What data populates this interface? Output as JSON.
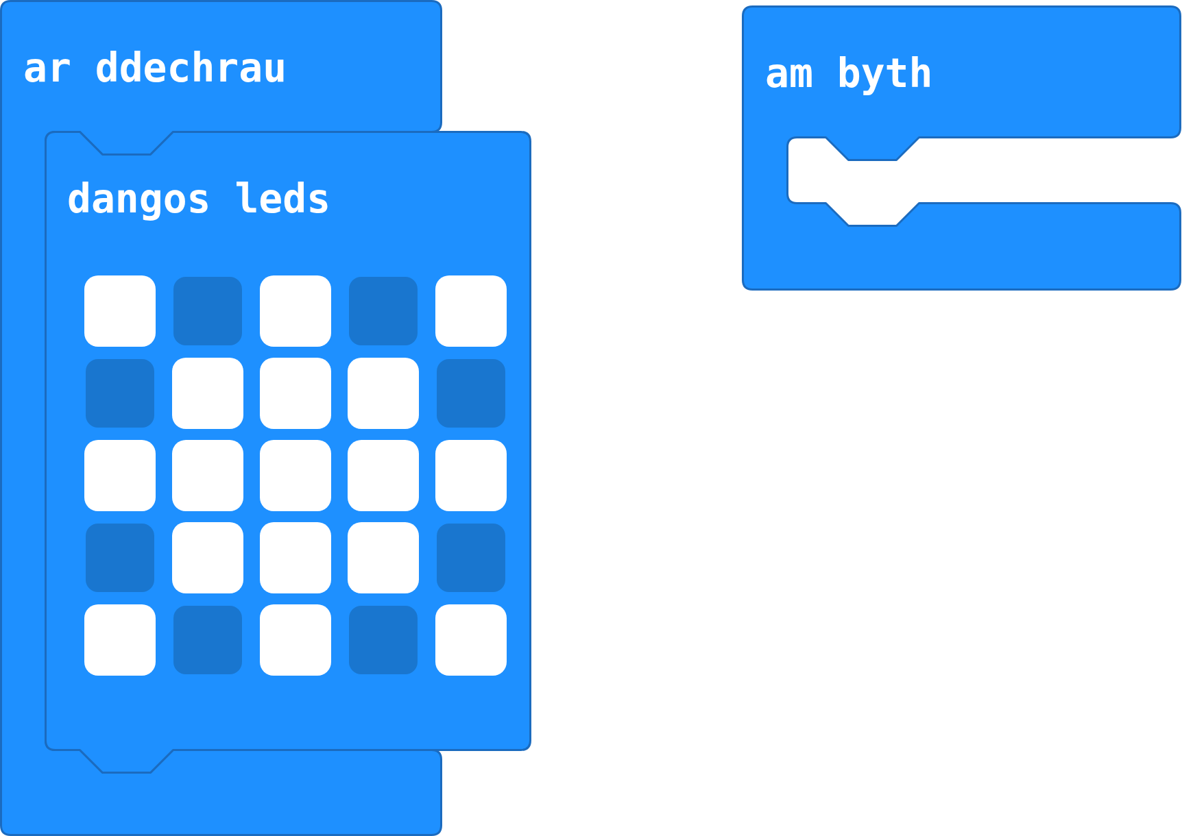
{
  "workspace": {
    "blocks": [
      {
        "label": "ar ddechrau",
        "body": [
          {
            "label": "dangos leds",
            "led_rows": [
              {
                "leds": [
                  {
                    "on": true
                  },
                  {
                    "on": false
                  },
                  {
                    "on": true
                  },
                  {
                    "on": false
                  },
                  {
                    "on": true
                  }
                ]
              },
              {
                "leds": [
                  {
                    "on": false
                  },
                  {
                    "on": true
                  },
                  {
                    "on": true
                  },
                  {
                    "on": true
                  },
                  {
                    "on": false
                  }
                ]
              },
              {
                "leds": [
                  {
                    "on": true
                  },
                  {
                    "on": true
                  },
                  {
                    "on": true
                  },
                  {
                    "on": true
                  },
                  {
                    "on": true
                  }
                ]
              },
              {
                "leds": [
                  {
                    "on": false
                  },
                  {
                    "on": true
                  },
                  {
                    "on": true
                  },
                  {
                    "on": true
                  },
                  {
                    "on": false
                  }
                ]
              },
              {
                "leds": [
                  {
                    "on": true
                  },
                  {
                    "on": false
                  },
                  {
                    "on": true
                  },
                  {
                    "on": false
                  },
                  {
                    "on": true
                  }
                ]
              }
            ]
          }
        ]
      },
      {
        "label": "am byth"
      }
    ]
  }
}
